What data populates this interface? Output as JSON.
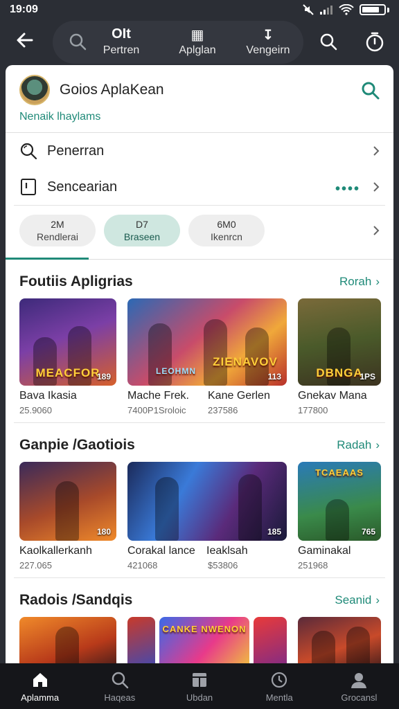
{
  "status_bar": {
    "time": "19:09"
  },
  "top_nav": {
    "tabs": [
      {
        "icon": "oit-logo-icon",
        "glyph": "OIt",
        "label": "Pertren"
      },
      {
        "icon": "apps-grid-icon",
        "glyph": "▦",
        "label": "Aplglan"
      },
      {
        "icon": "download-icon",
        "glyph": "↧",
        "label": "Vengeirn"
      }
    ]
  },
  "header": {
    "title": "Goios AplaKean",
    "subtitle": "Nenaik lhaylams"
  },
  "menu": [
    {
      "icon": "search-icon",
      "label": "Penerran"
    },
    {
      "icon": "bookmark-icon",
      "label": "Sencearian",
      "indicator": "••••"
    }
  ],
  "chips": [
    {
      "count": "2M",
      "label": "Rendlerai"
    },
    {
      "count": "D7",
      "label": "Braseen"
    },
    {
      "count": "6M0",
      "label": "Ikenrcn"
    }
  ],
  "sections": [
    {
      "title": "Foutiis Apligrias",
      "more": "Rorah",
      "apps": [
        {
          "name": "Bava Ikasia",
          "size": "25.9060",
          "badge": "189",
          "art": "MEACFOR"
        },
        {
          "name": "Mache Frek.",
          "size": "7400P1Sroloic",
          "badge": "",
          "art": "LEOHMN"
        },
        {
          "name": "Kane Gerlen",
          "size": "237586",
          "badge": "113",
          "art": "ZIENAVOV"
        },
        {
          "name": "Gnekav Mana",
          "size": "177800",
          "badge": "1PS",
          "art": "DBNGA"
        }
      ]
    },
    {
      "title": "Ganpie /Gaotiois",
      "more": "Radah",
      "apps": [
        {
          "name": "Kaolkallerkanh",
          "size": "227.065",
          "badge": "180",
          "art": ""
        },
        {
          "name": "Corakal lance",
          "size": "421068",
          "badge": "",
          "art": ""
        },
        {
          "name": "Ieaklsah",
          "size": "$53806",
          "badge": "185",
          "art": ""
        },
        {
          "name": "Gaminakal",
          "size": "251968",
          "badge": "765",
          "art": "TCAEAAS"
        }
      ]
    },
    {
      "title": "Radois /Sandqis",
      "more": "Seanid",
      "apps": [
        {
          "name": "",
          "size": "",
          "badge": "",
          "art": ""
        },
        {
          "name": "",
          "size": "",
          "badge": "",
          "art": "CANKE NWENON"
        },
        {
          "name": "",
          "size": "",
          "badge": "",
          "art": ""
        },
        {
          "name": "",
          "size": "",
          "badge": "",
          "art": ""
        }
      ]
    }
  ],
  "bottom_nav": [
    {
      "icon": "home-icon",
      "label": "Aplamma",
      "active": true
    },
    {
      "icon": "search-icon",
      "label": "Haqeas",
      "active": false
    },
    {
      "icon": "apps-icon",
      "label": "Ubdan",
      "active": false
    },
    {
      "icon": "clock-icon",
      "label": "Mentla",
      "active": false
    },
    {
      "icon": "profile-icon",
      "label": "Grocansl",
      "active": false
    }
  ],
  "colors": {
    "accent": "#1f8a78",
    "dark_bg": "#2b2e35",
    "nav_bg": "#15161a"
  }
}
